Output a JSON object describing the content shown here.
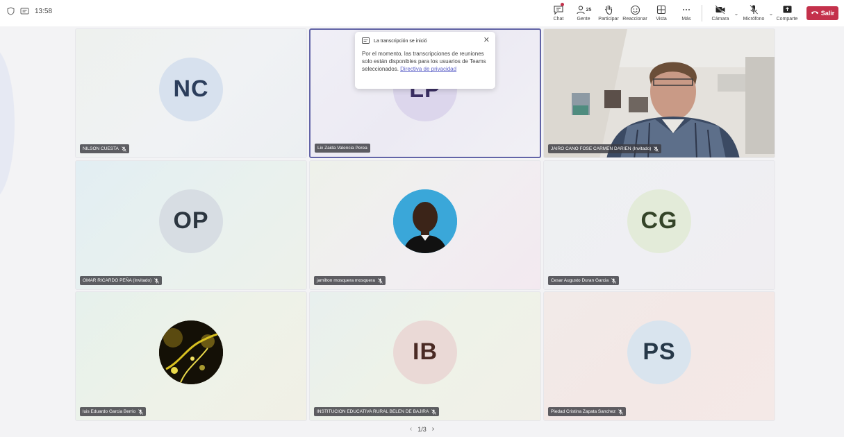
{
  "topbar": {
    "time": "13:58",
    "chat_label": "Chat",
    "people_label": "Gente",
    "people_count": "25",
    "raise_label": "Participar",
    "react_label": "Reaccionar",
    "view_label": "Vista",
    "more_label": "Más",
    "camera_label": "Cámara",
    "mic_label": "Micrófono",
    "share_label": "Comparte",
    "leave_label": "Salir"
  },
  "tiles": [
    {
      "initials": "NC",
      "name": "NILSON CUESTA",
      "avatar_color": "#d7e1ee",
      "initials_color": "#2c3e5c"
    },
    {
      "initials": "LP",
      "name": "Lix Zaida Valencia Perea",
      "avatar_color": "#dcd6ec",
      "initials_color": "#3b2f63"
    },
    {
      "initials": "",
      "name": "JAIRO CANO FOSE CARMEN DARIEN (Invitado)"
    },
    {
      "initials": "OP",
      "name": "OMAR RICARDO PEÑA (Invitado)",
      "avatar_color": "#d7dde3",
      "initials_color": "#2c3640"
    },
    {
      "initials": "",
      "name": "jamilton mosquera mosquera"
    },
    {
      "initials": "CG",
      "name": "Cesar Augusto Duran Garcia",
      "avatar_color": "#e3ebd9",
      "initials_color": "#344428"
    },
    {
      "initials": "",
      "name": "luis Eduardo Garcia Berrio"
    },
    {
      "initials": "IB",
      "name": "INSTITUCION EDUCATIVA RURAL BELEN DE BAJIRA",
      "avatar_color": "#ead9d6",
      "initials_color": "#4a2a24"
    },
    {
      "initials": "PS",
      "name": "Piedad Cristina Zapata Sanchez",
      "avatar_color": "#d9e4ee",
      "initials_color": "#263848"
    }
  ],
  "popup": {
    "title": "La transcripción se inició",
    "body": "Por el momento, las transcripciones de reuniones solo están disponibles para los usuarios de Teams seleccionados. ",
    "link": "Directiva de privacidad"
  },
  "pager": {
    "page": "1/3"
  }
}
